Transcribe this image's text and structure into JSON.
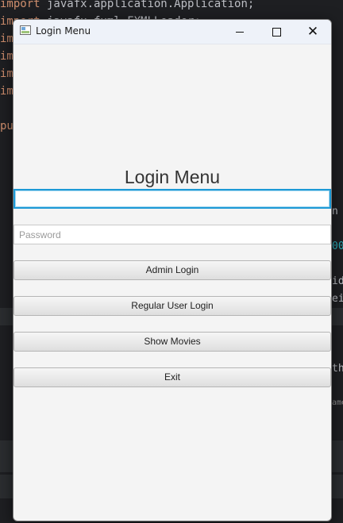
{
  "background": {
    "code_lines": [
      {
        "keyword": "import",
        "rest": " javafx.application.Application;"
      },
      {
        "keyword": "import",
        "rest": " javafx.fxml.FXMLLoader;"
      },
      {
        "keyword": "im",
        "rest": ""
      },
      {
        "keyword": "im",
        "rest": ""
      },
      {
        "keyword": "im",
        "rest": ""
      },
      {
        "keyword": "im",
        "rest": ""
      },
      {
        "keyword": "",
        "rest": ""
      },
      {
        "keyword": "pu",
        "rest": ""
      }
    ],
    "right_fragments": [
      "n",
      "00",
      "id",
      "ei",
      "th",
      "ame"
    ]
  },
  "window": {
    "title": "Login Menu",
    "controls": {
      "minimize": "minimize-icon",
      "maximize": "maximize-icon",
      "close": "close-icon"
    }
  },
  "form": {
    "heading": "Login Menu",
    "username": {
      "value": "",
      "placeholder": ""
    },
    "password": {
      "value": "",
      "placeholder": "Password"
    },
    "buttons": {
      "admin": "Admin Login",
      "regular": "Regular User Login",
      "movies": "Show Movies",
      "exit": "Exit"
    }
  },
  "colors": {
    "ide_background": "#1e1f22",
    "keyword": "#cf8e6d",
    "focus_ring": "#1e9ad6",
    "window_background": "#f4f4f4"
  }
}
